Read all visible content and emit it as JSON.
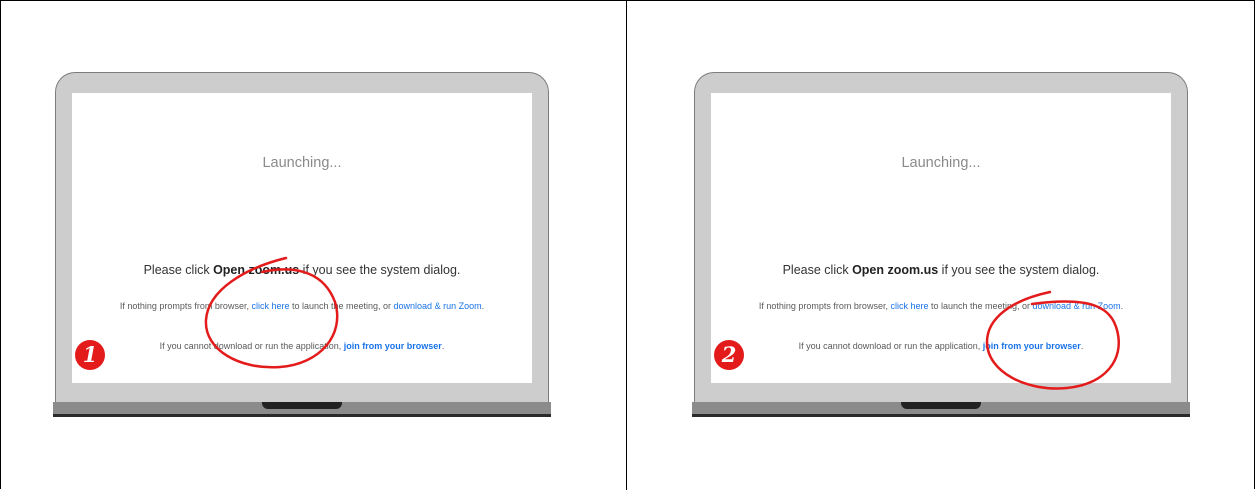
{
  "panels": [
    {
      "step": "1",
      "launching": "Launching...",
      "line1_pre": "Please click ",
      "line1_bold": "Open zoom.us",
      "line1_post": " if you see the system dialog.",
      "line2_pre": "If nothing prompts from browser, ",
      "line2_link1": "click here",
      "line2_mid": " to launch the meeting, or ",
      "line2_link2": "download & run Zoom",
      "line2_post": ".",
      "line3_pre": "If you cannot download or run the application, ",
      "line3_link": "join from your browser",
      "line3_post": ".",
      "highlight_target": "click-here-link"
    },
    {
      "step": "2",
      "launching": "Launching...",
      "line1_pre": "Please click ",
      "line1_bold": "Open zoom.us",
      "line1_post": " if you see the system dialog.",
      "line2_pre": "If nothing prompts from browser, ",
      "line2_link1": "click here",
      "line2_mid": " to launch the meeting, or ",
      "line2_link2": "download & run Zoom",
      "line2_post": ".",
      "line3_pre": "If you cannot download or run the application, ",
      "line3_link": "join from your browser",
      "line3_post": ".",
      "highlight_target": "join-from-browser-link"
    }
  ],
  "colors": {
    "highlight": "#e31b1b",
    "link": "#1a73e8",
    "lid": "#cdcdcd",
    "base": "#8b8b8b"
  }
}
